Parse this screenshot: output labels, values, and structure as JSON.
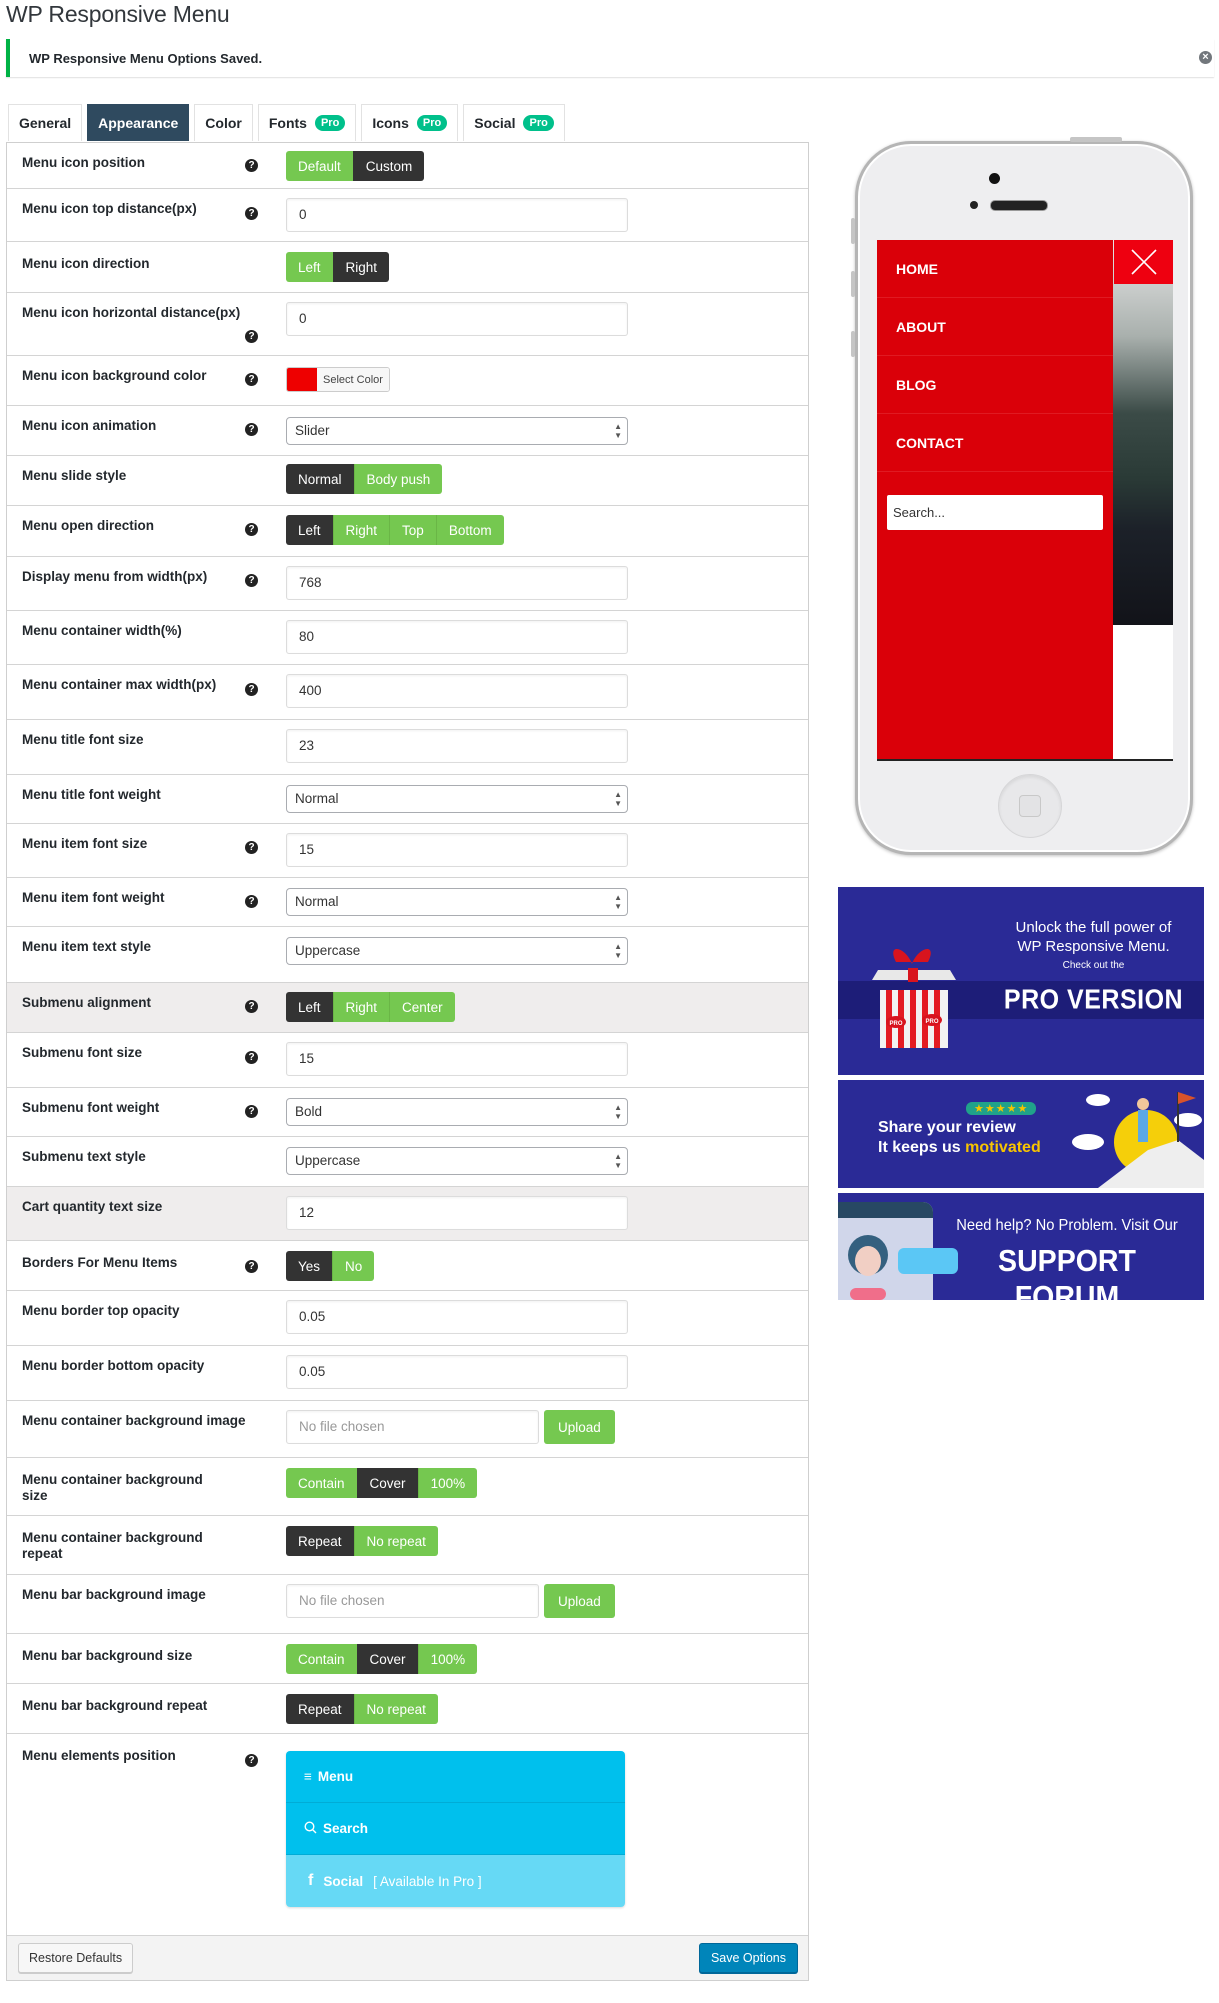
{
  "page": {
    "title": "WP Responsive Menu",
    "notice": "WP Responsive Menu Options Saved.",
    "notice_close_icon": "dismiss-icon"
  },
  "tabs": [
    {
      "label": "General",
      "active": false,
      "pro": false
    },
    {
      "label": "Appearance",
      "active": true,
      "pro": false
    },
    {
      "label": "Color",
      "active": false,
      "pro": false
    },
    {
      "label": "Fonts",
      "active": false,
      "pro": true
    },
    {
      "label": "Icons",
      "active": false,
      "pro": true
    },
    {
      "label": "Social",
      "active": false,
      "pro": true
    }
  ],
  "pro_badge": "Pro",
  "help_glyph": "?",
  "select_arrows": "▲\n▼",
  "rows": {
    "icon_position": {
      "label": "Menu icon position",
      "options": [
        "Default",
        "Custom"
      ],
      "selected": "Custom"
    },
    "icon_top_distance": {
      "label": "Menu icon top distance(px)",
      "value": "0"
    },
    "icon_direction": {
      "label": "Menu icon direction",
      "options": [
        "Left",
        "Right"
      ],
      "selected": "Right"
    },
    "icon_horizontal_distance": {
      "label": "Menu icon horizontal distance(px)",
      "value": "0"
    },
    "icon_bg_color": {
      "label": "Menu icon background color",
      "button": "Select Color",
      "color": "#ee0000"
    },
    "icon_animation": {
      "label": "Menu icon animation",
      "value": "Slider"
    },
    "slide_style": {
      "label": "Menu slide style",
      "options": [
        "Normal",
        "Body push"
      ],
      "selected": "Normal"
    },
    "open_direction": {
      "label": "Menu open direction",
      "options": [
        "Left",
        "Right",
        "Top",
        "Bottom"
      ],
      "selected": "Left"
    },
    "display_from_width": {
      "label": "Display menu from width(px)",
      "value": "768"
    },
    "container_width": {
      "label": "Menu container width(%)",
      "value": "80"
    },
    "container_max_width": {
      "label": "Menu container max width(px)",
      "value": "400"
    },
    "title_font_size": {
      "label": "Menu title font size",
      "value": "23"
    },
    "title_font_weight": {
      "label": "Menu title font weight",
      "value": "Normal"
    },
    "item_font_size": {
      "label": "Menu item font size",
      "value": "15"
    },
    "item_font_weight": {
      "label": "Menu item font weight",
      "value": "Normal"
    },
    "item_text_style": {
      "label": "Menu item text style",
      "value": "Uppercase"
    },
    "submenu_alignment": {
      "label": "Submenu alignment",
      "options": [
        "Left",
        "Right",
        "Center"
      ],
      "selected": "Left"
    },
    "submenu_font_size": {
      "label": "Submenu font size",
      "value": "15"
    },
    "submenu_font_weight": {
      "label": "Submenu font weight",
      "value": "Bold"
    },
    "submenu_text_style": {
      "label": "Submenu text style",
      "value": "Uppercase"
    },
    "cart_qty_text_size": {
      "label": "Cart quantity text size",
      "value": "12"
    },
    "borders_menu_items": {
      "label": "Borders For Menu Items",
      "options": [
        "Yes",
        "No"
      ],
      "selected": "Yes"
    },
    "border_top_opacity": {
      "label": "Menu border top opacity",
      "value": "0.05"
    },
    "border_bottom_opacity": {
      "label": "Menu border bottom opacity",
      "value": "0.05"
    },
    "container_bg_image": {
      "label": "Menu container background image",
      "placeholder": "No file chosen",
      "button": "Upload"
    },
    "container_bg_size": {
      "label": "Menu container background size",
      "options": [
        "Contain",
        "Cover",
        "100%"
      ],
      "selected": "Cover"
    },
    "container_bg_repeat": {
      "label": "Menu container background repeat",
      "options": [
        "Repeat",
        "No repeat"
      ],
      "selected": "Repeat"
    },
    "bar_bg_image": {
      "label": "Menu bar background image",
      "placeholder": "No file chosen",
      "button": "Upload"
    },
    "bar_bg_size": {
      "label": "Menu bar background size",
      "options": [
        "Contain",
        "Cover",
        "100%"
      ],
      "selected": "Cover"
    },
    "bar_bg_repeat": {
      "label": "Menu bar background repeat",
      "options": [
        "Repeat",
        "No repeat"
      ],
      "selected": "Repeat"
    },
    "elements_position": {
      "label": "Menu elements position",
      "items": [
        {
          "icon": "≡",
          "icon_name": "hamburger-icon",
          "label": "Menu",
          "note": ""
        },
        {
          "icon": "⚲",
          "icon_name": "search-icon",
          "label": "Search",
          "note": ""
        },
        {
          "icon": "f",
          "icon_name": "facebook-icon",
          "label": "Social",
          "note": "[ Available In Pro ]"
        }
      ]
    }
  },
  "footer": {
    "restore": "Restore Defaults",
    "save": "Save Options"
  },
  "preview": {
    "menu_items": [
      "HOME",
      "ABOUT",
      "BLOG",
      "CONTACT"
    ],
    "search_placeholder": "Search...",
    "menu_color": "#da0009"
  },
  "banners": {
    "pro": {
      "line1": "Unlock the full power of",
      "line2": "WP Responsive Menu.",
      "line3": "Check out the",
      "line4": "PRO VERSION",
      "box_label": "PRO"
    },
    "review": {
      "line1": "Share your review",
      "line2a": "It keeps us ",
      "line2b": "motivated",
      "stars": "★★★★★"
    },
    "support": {
      "line1": "Need help? No Problem. Visit Our",
      "line2": "SUPPORT FORUM"
    }
  },
  "colors": {
    "toggle_active": "#333333",
    "toggle_inactive": "#75c850",
    "tab_active": "#2f4a5f",
    "pro_badge": "#00c08b",
    "save_button": "#0085ba",
    "sortable": "#00c0ed",
    "sortable_disabled": "#66d9f5",
    "banner_bg": "#2a2a96"
  }
}
